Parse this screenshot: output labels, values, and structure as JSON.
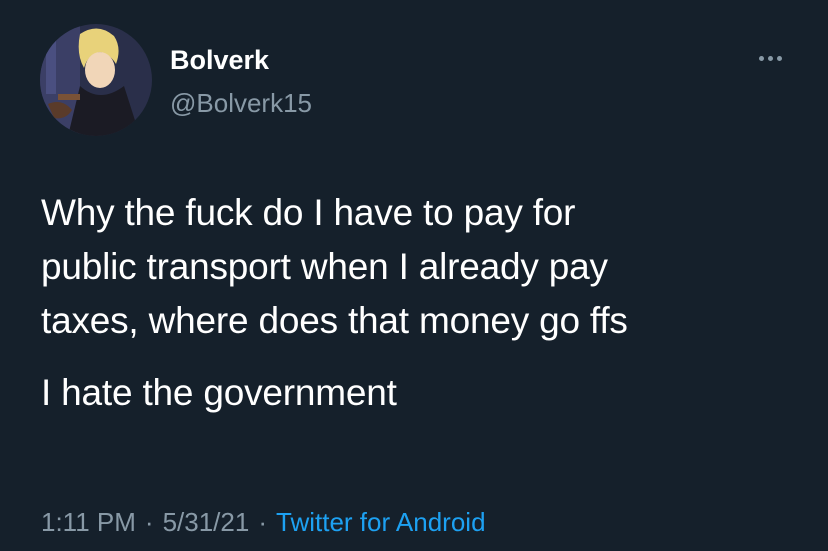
{
  "tweet": {
    "author": {
      "display_name": "Bolverk",
      "handle": "@Bolverk15",
      "avatar_icon": "profile-avatar"
    },
    "more_icon": "more-options-icon",
    "text": {
      "line1": "Why the fuck do I have to pay for",
      "line2": "public transport when I already pay",
      "line3": "taxes, where does that money go ffs",
      "paragraph2": "I hate the government"
    },
    "meta": {
      "time": "1:11 PM",
      "separator": "·",
      "date": "5/31/21",
      "source": "Twitter for Android"
    }
  },
  "colors": {
    "background": "#15202b",
    "primary_text": "#ffffff",
    "secondary_text": "#8899a6",
    "link": "#1da1f2"
  }
}
